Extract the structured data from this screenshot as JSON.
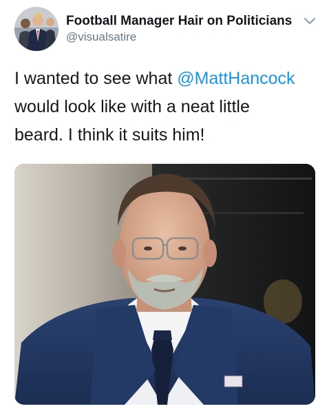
{
  "tweet": {
    "author_name": "Football Manager Hair on Politicians",
    "author_handle": "@visualsatire",
    "text_before_mention": "I wanted to see what ",
    "mention": "@MattHancock",
    "text_line2": "would look like with a neat little",
    "text_line3": "beard. I think it suits him!",
    "icons": {
      "menu": "chevron-down-icon",
      "avatar": "avatar"
    },
    "colors": {
      "link": "#1b95e0",
      "handle": "#657786",
      "text": "#14171a"
    }
  }
}
